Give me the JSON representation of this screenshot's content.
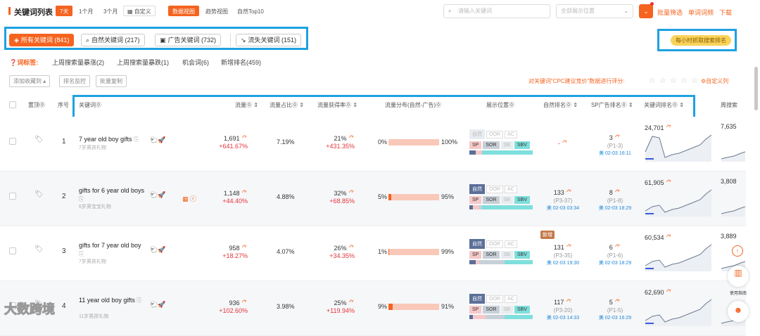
{
  "header": {
    "title": "关键词列表",
    "ranges": [
      "7天",
      "1个月",
      "3个月",
      "自定义"
    ],
    "views": [
      "数据视图",
      "趋势视图",
      "自然Top10"
    ],
    "search_placeholder": "请输入关键词",
    "select_value": "全部展示位置",
    "links": [
      "批量筛选",
      "单词词频",
      "下载"
    ]
  },
  "kw_tabs": [
    {
      "label": "所有关键词 (841)"
    },
    {
      "label": "自然关键词 (217)"
    },
    {
      "label": "广告关键词 (732)"
    },
    {
      "label": "流失关键词 (151)"
    }
  ],
  "hourly_btn": "每小时抓取搜索排名",
  "tag_label": "词标签:",
  "tags": [
    "上周搜索量暴涨(2)",
    "上周搜索量暴跌(1)",
    "机会词(6)",
    "新增排名(459)"
  ],
  "buttons": [
    "添加收藏到 ▴",
    "排名监控",
    "批量复制"
  ],
  "cpc_text": "对关键词“CPC建议竞价”数据进行评分:",
  "custom_words": "自定义列",
  "columns": [
    "置顶",
    "序号",
    "关键词",
    "流量",
    "流量占比",
    "流量获得率",
    "流量分布(自然-广告)",
    "展示位置",
    "自然排名",
    "SP广告排名",
    "关键词排名",
    "周搜索"
  ],
  "rows": [
    {
      "idx": "1",
      "kw": "7 year old boy gifts",
      "sub": "7岁男孩礼物",
      "traffic": "1,691",
      "traffic_chg": "+641.67%",
      "share": "7.19%",
      "rate": "21%",
      "rate_chg": "+431.35%",
      "dist_l": "0%",
      "dist_r": "100%",
      "dist": 0,
      "nat": "-",
      "nat_sub": "",
      "nat_time": "",
      "sp": "3",
      "sp_sub": "(P1-3)",
      "sp_time": "美 02-03 16:11",
      "krank": "24,701",
      "wsearch": "7,635"
    },
    {
      "idx": "2",
      "kw": "gifts for 6 year old boys",
      "sub": "6岁男宝宝礼物",
      "traffic": "1,148",
      "traffic_chg": "+44.40%",
      "share": "4.88%",
      "rate": "32%",
      "rate_chg": "+68.85%",
      "dist_l": "5%",
      "dist_r": "95%",
      "dist": 5,
      "nat": "133",
      "nat_sub": "(P3-37)",
      "nat_time": "美 02-03 03:34",
      "sp": "8",
      "sp_sub": "(P1-8)",
      "sp_time": "美 02-03 18:29",
      "krank": "61,905",
      "wsearch": "3,808"
    },
    {
      "idx": "3",
      "kw": "gifts for 7 year old boy",
      "sub": "7岁男孩礼物",
      "traffic": "958",
      "traffic_chg": "+18.27%",
      "share": "4.07%",
      "rate": "26%",
      "rate_chg": "+34.35%",
      "dist_l": "1%",
      "dist_r": "99%",
      "dist": 1,
      "nat": "131",
      "nat_sub": "(P3-35)",
      "nat_time": "美 02-03 19:30",
      "sp": "6",
      "sp_sub": "(P1-6)",
      "sp_time": "美 02-03 18:29",
      "krank": "60,534",
      "wsearch": "3,889"
    },
    {
      "idx": "4",
      "kw": "11 year old boy gifts",
      "sub": "11岁男孩礼物",
      "traffic": "936",
      "traffic_chg": "+102.60%",
      "share": "3.98%",
      "rate": "25%",
      "rate_chg": "+119.94%",
      "dist_l": "9%",
      "dist_r": "91%",
      "dist": 9,
      "nat": "117",
      "nat_sub": "(P3-20)",
      "nat_time": "美 02-03 14:33",
      "sp": "5",
      "sp_sub": "(P1-5)",
      "sp_time": "美 02-03 16:29",
      "krank": "62,690",
      "wsearch": ""
    }
  ],
  "new_badge": "新增",
  "pos_chips": [
    "自然",
    "OOR",
    "AC",
    "SP",
    "SOR",
    "SB",
    "SBV"
  ],
  "side_label": "使用指南",
  "watermark": "大数跨境"
}
